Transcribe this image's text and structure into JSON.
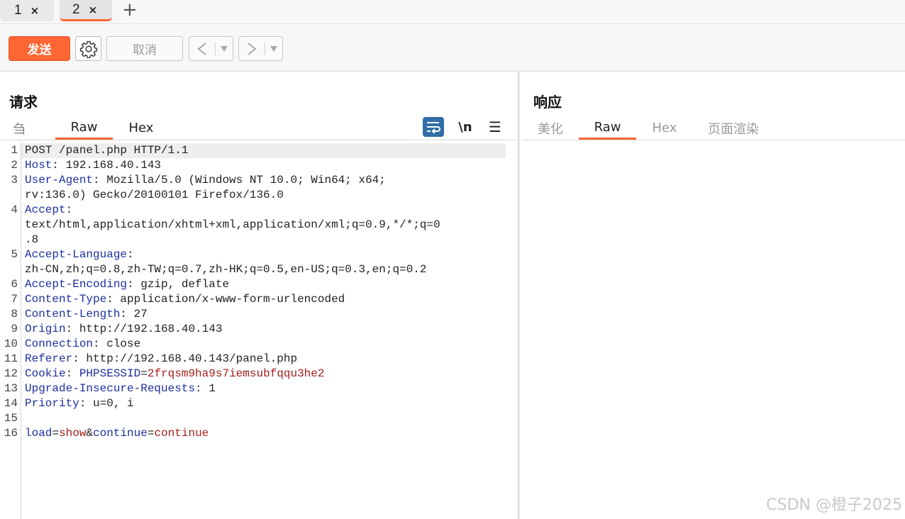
{
  "tabs": [
    {
      "label": "1",
      "close": "×"
    },
    {
      "label": "2",
      "close": "×"
    }
  ],
  "add_tab": "+",
  "toolbar": {
    "send_label": "发送",
    "cancel_label": "取消",
    "back_glyph": "<",
    "forward_glyph": ">",
    "dropdown_glyph": "▾"
  },
  "request": {
    "title": "请求",
    "tabs": [
      "刍",
      "Raw",
      "Hex"
    ],
    "active_tab": "Raw",
    "tools": {
      "newline": "\\n",
      "menu": "☰"
    },
    "lines": [
      {
        "n": "1",
        "parts": [
          {
            "t": "v",
            "s": "POST /panel.php HTTP/1.1"
          }
        ]
      },
      {
        "n": "2",
        "parts": [
          {
            "t": "k",
            "s": "Host"
          },
          {
            "t": "v",
            "s": ": 192.168.40.143"
          }
        ]
      },
      {
        "n": "3",
        "parts": [
          {
            "t": "k",
            "s": "User-Agent"
          },
          {
            "t": "v",
            "s": ": Mozilla/5.0 (Windows NT 10.0; Win64; x64;"
          }
        ]
      },
      {
        "n": "",
        "parts": [
          {
            "t": "v",
            "s": "rv:136.0) Gecko/20100101 Firefox/136.0"
          }
        ]
      },
      {
        "n": "4",
        "parts": [
          {
            "t": "k",
            "s": "Accept"
          },
          {
            "t": "v",
            "s": ":"
          }
        ]
      },
      {
        "n": "",
        "parts": [
          {
            "t": "v",
            "s": "text/html,application/xhtml+xml,application/xml;q=0.9,*/*;q=0"
          }
        ]
      },
      {
        "n": "",
        "parts": [
          {
            "t": "v",
            "s": ".8"
          }
        ]
      },
      {
        "n": "5",
        "parts": [
          {
            "t": "k",
            "s": "Accept-Language"
          },
          {
            "t": "v",
            "s": ":"
          }
        ]
      },
      {
        "n": "",
        "parts": [
          {
            "t": "v",
            "s": "zh-CN,zh;q=0.8,zh-TW;q=0.7,zh-HK;q=0.5,en-US;q=0.3,en;q=0.2"
          }
        ]
      },
      {
        "n": "6",
        "parts": [
          {
            "t": "k",
            "s": "Accept-Encoding"
          },
          {
            "t": "v",
            "s": ": gzip, deflate"
          }
        ]
      },
      {
        "n": "7",
        "parts": [
          {
            "t": "k",
            "s": "Content-Type"
          },
          {
            "t": "v",
            "s": ": application/x-www-form-urlencoded"
          }
        ]
      },
      {
        "n": "8",
        "parts": [
          {
            "t": "k",
            "s": "Content-Length"
          },
          {
            "t": "v",
            "s": ": 27"
          }
        ]
      },
      {
        "n": "9",
        "parts": [
          {
            "t": "k",
            "s": "Origin"
          },
          {
            "t": "v",
            "s": ": http://192.168.40.143"
          }
        ]
      },
      {
        "n": "10",
        "parts": [
          {
            "t": "k",
            "s": "Connection"
          },
          {
            "t": "v",
            "s": ": close"
          }
        ]
      },
      {
        "n": "11",
        "parts": [
          {
            "t": "k",
            "s": "Referer"
          },
          {
            "t": "v",
            "s": ": http://192.168.40.143/panel.php"
          }
        ]
      },
      {
        "n": "12",
        "parts": [
          {
            "t": "k",
            "s": "Cookie"
          },
          {
            "t": "v",
            "s": ": "
          },
          {
            "t": "k",
            "s": "PHPSESSID"
          },
          {
            "t": "v",
            "s": "="
          },
          {
            "t": "p",
            "s": "2frqsm9ha9s7iemsubfqqu3he2"
          }
        ]
      },
      {
        "n": "13",
        "parts": [
          {
            "t": "k",
            "s": "Upgrade-Insecure-Requests"
          },
          {
            "t": "v",
            "s": ": 1"
          }
        ]
      },
      {
        "n": "14",
        "parts": [
          {
            "t": "k",
            "s": "Priority"
          },
          {
            "t": "v",
            "s": ": u=0, i"
          }
        ]
      },
      {
        "n": "15",
        "parts": []
      },
      {
        "n": "16",
        "parts": [
          {
            "t": "k",
            "s": "load"
          },
          {
            "t": "v",
            "s": "="
          },
          {
            "t": "p",
            "s": "show"
          },
          {
            "t": "v",
            "s": "&"
          },
          {
            "t": "k",
            "s": "continue"
          },
          {
            "t": "v",
            "s": "="
          },
          {
            "t": "p",
            "s": "continue"
          }
        ]
      }
    ]
  },
  "response": {
    "title": "响应",
    "tabs": [
      "美化",
      "Raw",
      "Hex",
      "页面渲染"
    ],
    "active_tab": "Raw"
  },
  "watermark": "CSDN @橙子2025",
  "colors": {
    "accent": "#ff6633",
    "header_key": "#1c2fa0",
    "param_value": "#a3201b"
  }
}
